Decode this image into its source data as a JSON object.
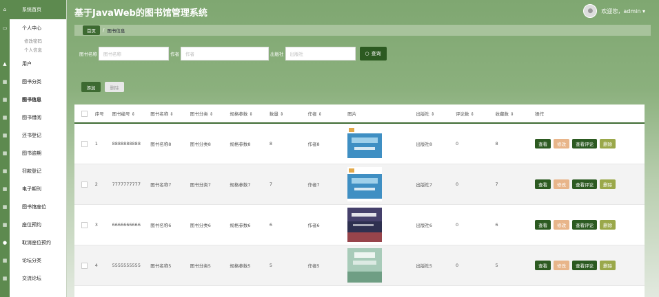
{
  "app": {
    "title": "基于JavaWeb的图书馆管理系统"
  },
  "user": {
    "greeting": "欢迎您，admin ▾"
  },
  "sidebar": {
    "items": [
      {
        "label": "系统首页",
        "icon": "home-icon"
      },
      {
        "label": "个人中心",
        "icon": "monitor-icon"
      },
      {
        "label": "修改密码",
        "sub": true
      },
      {
        "label": "个人信息",
        "sub": true
      },
      {
        "label": "用户",
        "icon": "user-icon"
      },
      {
        "label": "图书分类",
        "icon": "grid-icon"
      },
      {
        "label": "图书信息",
        "icon": "grid-icon"
      },
      {
        "label": "图书借阅",
        "icon": "grid-icon"
      },
      {
        "label": "还书登记",
        "icon": "grid-icon"
      },
      {
        "label": "图书逾期",
        "icon": "grid-icon"
      },
      {
        "label": "罚款登记",
        "icon": "grid-icon"
      },
      {
        "label": "电子期刊",
        "icon": "grid-icon"
      },
      {
        "label": "图书馆座位",
        "icon": "grid-icon"
      },
      {
        "label": "座位预约",
        "icon": "grid-icon"
      },
      {
        "label": "取消座位预约",
        "icon": "pin-icon"
      },
      {
        "label": "论坛分类",
        "icon": "grid-icon"
      },
      {
        "label": "交流论坛",
        "icon": "grid-icon"
      }
    ]
  },
  "breadcrumb": {
    "home": "首页",
    "current": "图书信息"
  },
  "search": {
    "name_label": "图书名称",
    "name_placeholder": "图书名称",
    "author_label": "作者",
    "author_placeholder": "作者",
    "publisher_label": "出版社",
    "publisher_placeholder": "出版社",
    "button": "查询"
  },
  "actions": {
    "add": "添加",
    "delete": "删除"
  },
  "table": {
    "headers": [
      "序号",
      "图书编号 ⇕",
      "图书名称 ⇕",
      "图书分类 ⇕",
      "规格参数 ⇕",
      "数量 ⇕",
      "作者 ⇕",
      "图片",
      "出版社 ⇕",
      "评论数 ⇕",
      "收藏数 ⇕",
      "操作"
    ],
    "rows": [
      {
        "idx": "1",
        "code": "8888888888",
        "name": "图书名称8",
        "cat": "图书分类8",
        "spec": "规格参数8",
        "qty": "8",
        "author": "作者8",
        "pub": "出版社8",
        "comments": "0",
        "fav": "8"
      },
      {
        "idx": "2",
        "code": "7777777777",
        "name": "图书名称7",
        "cat": "图书分类7",
        "spec": "规格参数7",
        "qty": "7",
        "author": "作者7",
        "pub": "出版社7",
        "comments": "0",
        "fav": "7"
      },
      {
        "idx": "3",
        "code": "6666666666",
        "name": "图书名称6",
        "cat": "图书分类6",
        "spec": "规格参数6",
        "qty": "6",
        "author": "作者6",
        "pub": "出版社6",
        "comments": "0",
        "fav": "6"
      },
      {
        "idx": "4",
        "code": "5555555555",
        "name": "图书名称5",
        "cat": "图书分类5",
        "spec": "规格参数5",
        "qty": "5",
        "author": "作者5",
        "pub": "出版社5",
        "comments": "0",
        "fav": "5"
      }
    ],
    "ops": {
      "view": "查看",
      "edit": "修改",
      "view_comment": "查看评论",
      "delete": "删除"
    }
  },
  "colors": {
    "accent": "#3d6a31",
    "edit": "#e8b58a",
    "delete": "#9aa84a"
  }
}
